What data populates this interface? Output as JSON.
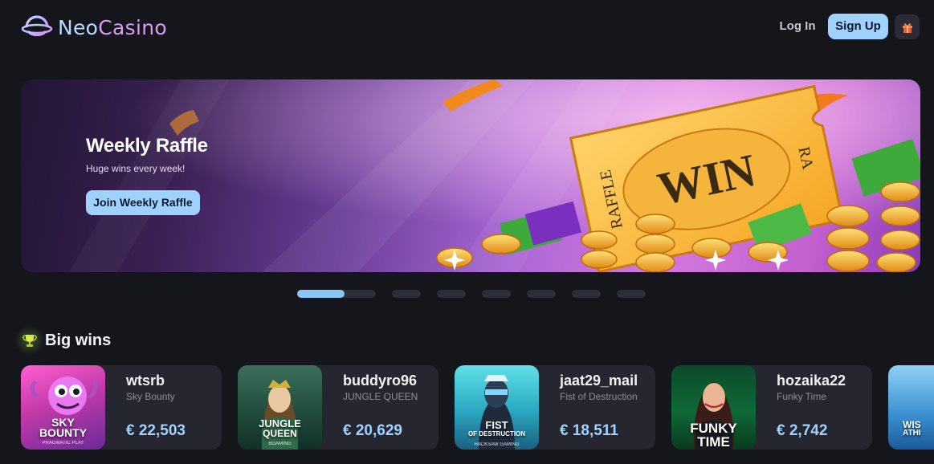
{
  "header": {
    "logo_neo": "Neo",
    "logo_casino": "Casino",
    "login_label": "Log In",
    "signup_label": "Sign Up",
    "gift_icon": "gift-icon"
  },
  "banner": {
    "title": "Weekly Raffle",
    "subtitle": "Huge wins every week!",
    "button_label": "Join Weekly Raffle",
    "ticket_text": "WIN",
    "ticket_side_left": "RAFFLE",
    "ticket_side_right": "RA"
  },
  "carousel": {
    "slide_count": 8,
    "active_index": 0,
    "active_progress": 0.6
  },
  "big_wins": {
    "title": "Big wins",
    "icon": "trophy-icon",
    "items": [
      {
        "user": "wtsrb",
        "game": "Sky Bounty",
        "amount": "€ 22,503",
        "thumb_title_1": "SKY",
        "thumb_title_2": "BOUNTY",
        "thumb_provider": "PRAGMATIC PLAY"
      },
      {
        "user": "buddyro96",
        "game": "JUNGLE QUEEN",
        "amount": "€ 20,629",
        "thumb_title_1": "JUNGLE",
        "thumb_title_2": "QUEEN",
        "thumb_provider": "BGAMING"
      },
      {
        "user": "jaat29_mail",
        "game": "Fist of Destruction",
        "amount": "€ 18,511",
        "thumb_title_1": "FIST",
        "thumb_title_2": "OF DESTRUCTION",
        "thumb_provider": "HACKSAW GAMING"
      },
      {
        "user": "hozaika22",
        "game": "Funky Time",
        "amount": "€ 2,742",
        "thumb_title_1": "FUNKY",
        "thumb_title_2": "TIME",
        "thumb_provider": ""
      },
      {
        "user": "",
        "game": "",
        "amount": "",
        "thumb_title_1": "WIS",
        "thumb_title_2": "ATHI",
        "thumb_provider": ""
      }
    ]
  },
  "colors": {
    "background": "#15151c",
    "accent": "#9fd2ff",
    "card": "#25262f"
  }
}
